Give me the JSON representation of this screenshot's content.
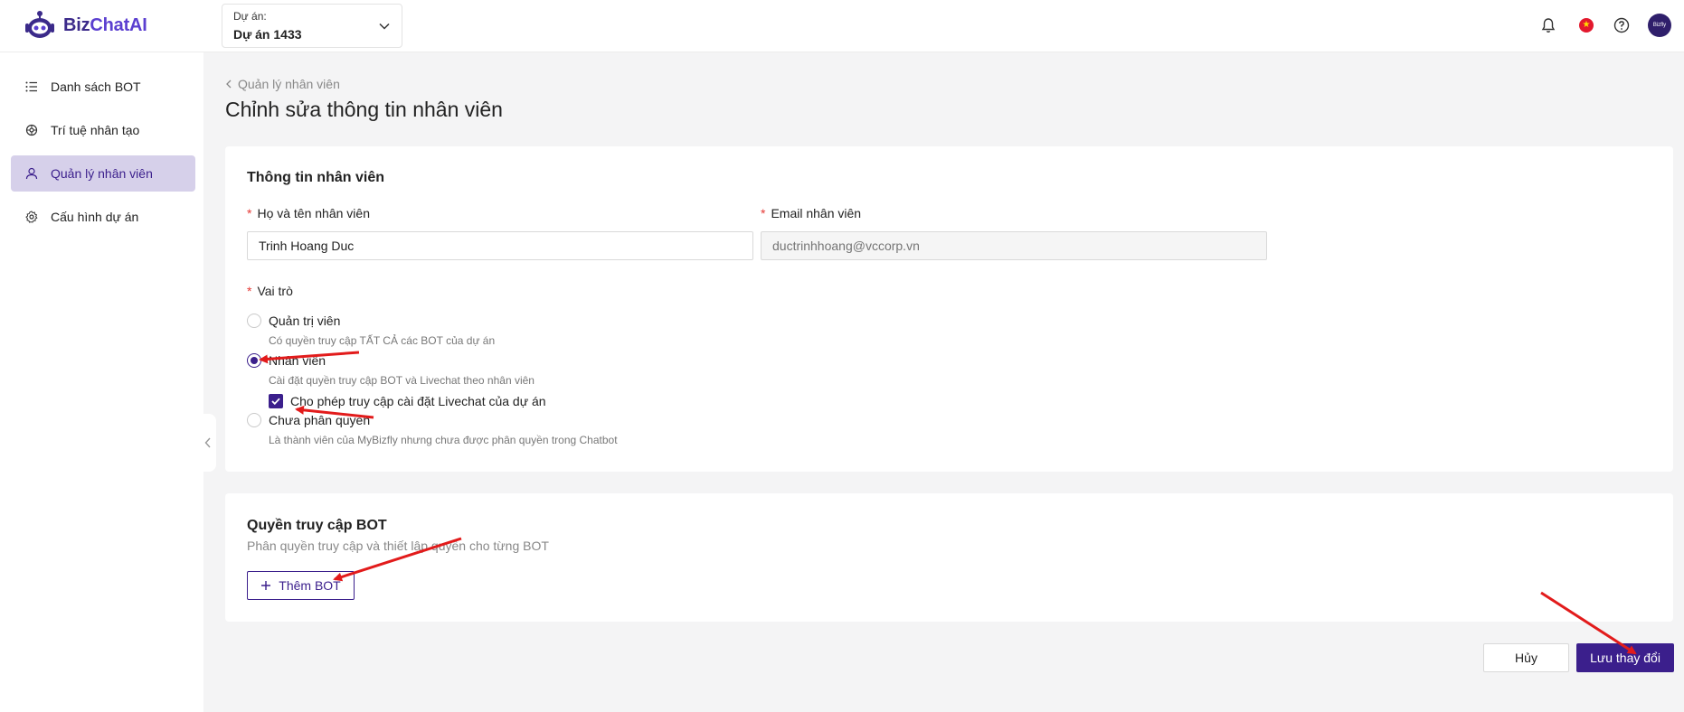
{
  "app": {
    "logo_text_a": "Biz",
    "logo_text_b": "ChatAI",
    "brand_color": "#3b1f8c"
  },
  "header": {
    "project_label": "Dự án:",
    "project_value": "Dự án 1433",
    "avatar_text": "Bizfly"
  },
  "sidebar": {
    "items": [
      {
        "label": "Danh sách BOT",
        "icon": "list-icon",
        "active": false
      },
      {
        "label": "Trí tuệ nhân tạo",
        "icon": "ai-icon",
        "active": false
      },
      {
        "label": "Quản lý nhân viên",
        "icon": "user-icon",
        "active": true
      },
      {
        "label": "Cấu hình dự án",
        "icon": "gear-icon",
        "active": false
      }
    ]
  },
  "page": {
    "breadcrumb": "Quản lý nhân viên",
    "title": "Chỉnh sửa thông tin nhân viên"
  },
  "employee_info": {
    "section_title": "Thông tin nhân viên",
    "name_label": "Họ và tên nhân viên",
    "name_value": "Trinh Hoang Duc",
    "email_label": "Email nhân viên",
    "email_placeholder": "ductrinhhoang@vccorp.vn",
    "required_mark": "*"
  },
  "role": {
    "label": "Vai trò",
    "options": [
      {
        "label": "Quản trị viên",
        "desc": "Có quyền truy cập TẤT CẢ các BOT của dự án",
        "checked": false
      },
      {
        "label": "Nhân viên",
        "desc": "Cài đặt quyền truy cập BOT và Livechat theo nhân viên",
        "checked": true
      },
      {
        "label": "Chưa phân quyền",
        "desc": "Là thành viên của MyBizfly nhưng chưa được phân quyền trong Chatbot",
        "checked": false
      }
    ],
    "livechat_checkbox_label": "Cho phép truy cập cài đặt Livechat của dự án",
    "livechat_checked": true
  },
  "bot_access": {
    "section_title": "Quyền truy cập BOT",
    "subtitle": "Phân quyền truy cập và thiết lập quyền cho từng BOT",
    "add_button": "Thêm BOT"
  },
  "footer": {
    "cancel": "Hủy",
    "save": "Lưu thay đổi"
  }
}
